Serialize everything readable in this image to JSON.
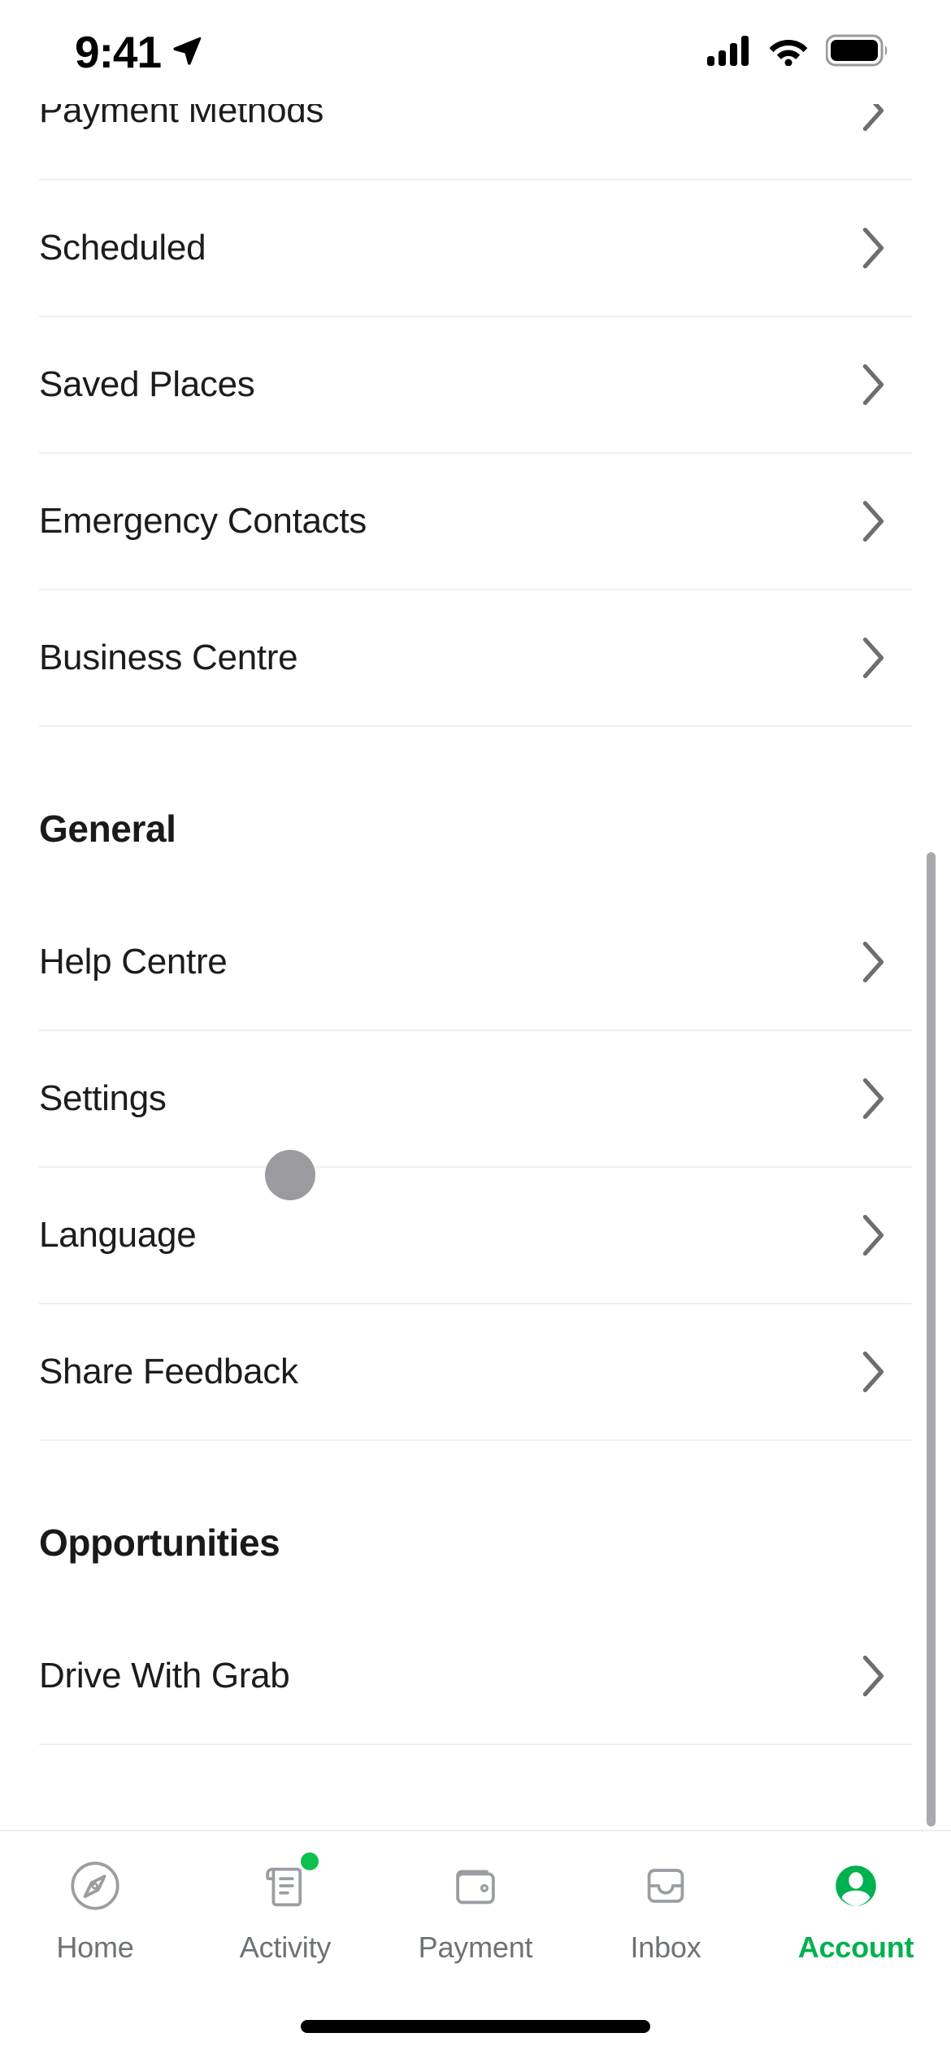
{
  "status_bar": {
    "time": "9:41",
    "location_icon": "location-arrow-icon",
    "signal_icon": "cellular-signal-icon",
    "wifi_icon": "wifi-icon",
    "battery_icon": "battery-full-icon"
  },
  "colors": {
    "brand_green": "#00B14F",
    "badge_green": "#0FBF4D",
    "divider": "#EFEFEF",
    "text_primary": "#1C1C1C",
    "tab_inactive": "#6E7276",
    "icon_gray": "#9B9B9F",
    "scrollbar": "#A9A9AD"
  },
  "content": {
    "clipped_row": {
      "label": "Payment Methods",
      "chevron": "chevron-right-icon"
    },
    "account_items": [
      {
        "label": "Scheduled",
        "chevron": "chevron-right-icon"
      },
      {
        "label": "Saved Places",
        "chevron": "chevron-right-icon"
      },
      {
        "label": "Emergency Contacts",
        "chevron": "chevron-right-icon"
      },
      {
        "label": "Business Centre",
        "chevron": "chevron-right-icon"
      }
    ],
    "general": {
      "heading": "General",
      "items": [
        {
          "label": "Help Centre",
          "chevron": "chevron-right-icon"
        },
        {
          "label": "Settings",
          "chevron": "chevron-right-icon"
        },
        {
          "label": "Language",
          "chevron": "chevron-right-icon"
        },
        {
          "label": "Share Feedback",
          "chevron": "chevron-right-icon"
        }
      ]
    },
    "opportunities": {
      "heading": "Opportunities",
      "items": [
        {
          "label": "Drive With Grab",
          "chevron": "chevron-right-icon"
        }
      ]
    }
  },
  "tab_bar": {
    "tabs": [
      {
        "label": "Home",
        "icon": "compass-icon",
        "active": false,
        "badge": false
      },
      {
        "label": "Activity",
        "icon": "receipt-icon",
        "active": false,
        "badge": true
      },
      {
        "label": "Payment",
        "icon": "wallet-icon",
        "active": false,
        "badge": false
      },
      {
        "label": "Inbox",
        "icon": "inbox-tray-icon",
        "active": false,
        "badge": false
      },
      {
        "label": "Account",
        "icon": "person-circle-filled-icon",
        "active": true,
        "badge": false
      }
    ]
  }
}
